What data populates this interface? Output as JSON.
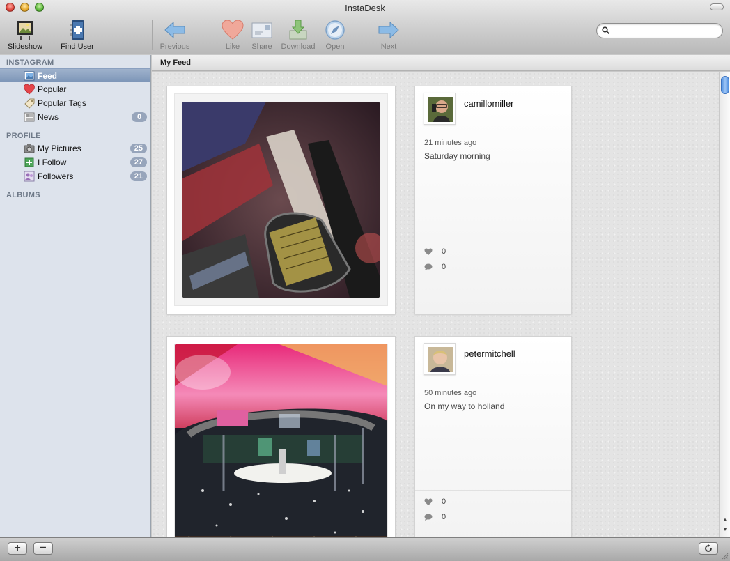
{
  "window": {
    "title": "InstaDesk"
  },
  "toolbar": {
    "slideshow": "Slideshow",
    "find_user": "Find User",
    "previous": "Previous",
    "like": "Like",
    "share": "Share",
    "download": "Download",
    "open": "Open",
    "next": "Next",
    "search_placeholder": ""
  },
  "sidebar": {
    "instagram_header": "INSTAGRAM",
    "instagram_items": [
      {
        "label": "Feed",
        "icon": "feed-icon",
        "selected": true
      },
      {
        "label": "Popular",
        "icon": "heart-icon"
      },
      {
        "label": "Popular Tags",
        "icon": "tag-icon"
      },
      {
        "label": "News",
        "icon": "news-icon",
        "badge": "0"
      }
    ],
    "profile_header": "PROFILE",
    "profile_items": [
      {
        "label": "My Pictures",
        "icon": "camera-icon",
        "badge": "25"
      },
      {
        "label": "I Follow",
        "icon": "follow-icon",
        "badge": "27"
      },
      {
        "label": "Followers",
        "icon": "followers-icon",
        "badge": "21"
      }
    ],
    "albums_header": "ALBUMS"
  },
  "content": {
    "header": "My Feed",
    "posts": [
      {
        "username": "camillomiller",
        "time": "21 minutes ago",
        "caption": "Saturday morning",
        "likes": "0",
        "comments": "0"
      },
      {
        "username": "petermitchell",
        "time": "50 minutes ago",
        "caption": "On my way to holland",
        "likes": "0",
        "comments": "0"
      }
    ]
  },
  "colors": {
    "sidebar_bg": "#dde3ec",
    "selection": "#7c95b7",
    "badge": "#97a5bb",
    "accent_blue": "#4f8fe0"
  }
}
